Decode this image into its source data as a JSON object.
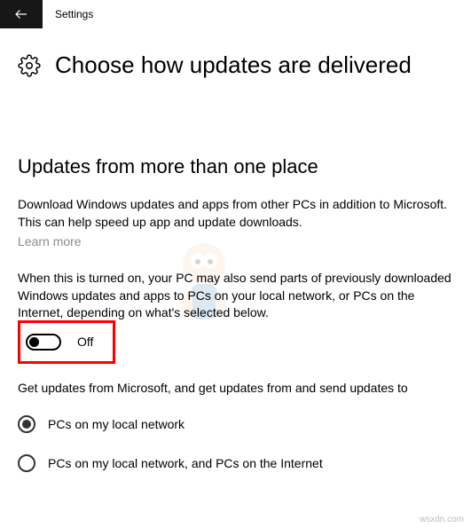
{
  "titlebar": {
    "label": "Settings"
  },
  "page": {
    "heading": "Choose how updates are delivered"
  },
  "section": {
    "heading": "Updates from more than one place",
    "paragraph1": "Download Windows updates and apps from other PCs in addition to Microsoft. This can help speed up app and update downloads.",
    "learn_more": "Learn more",
    "paragraph2": "When this is turned on, your PC may also send parts of previously downloaded Windows updates and apps to PCs on your local network, or PCs on the Internet, depending on what's selected below."
  },
  "toggle": {
    "state_label": "Off"
  },
  "sub_description": "Get updates from Microsoft, and get updates from and send updates to",
  "options": [
    {
      "label": "PCs on my local network",
      "selected": true
    },
    {
      "label": "PCs on my local network, and PCs on the Internet",
      "selected": false
    }
  ],
  "watermark": "wsxdn.com"
}
